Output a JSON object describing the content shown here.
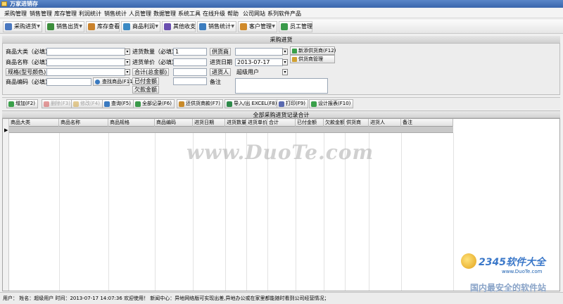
{
  "window": {
    "title": "万家进销存"
  },
  "menu": [
    "采购管理",
    "销售管理",
    "库存管理",
    "利润统计",
    "销售统计",
    "人员管理",
    "数据管理",
    "系统工具",
    "在线升级",
    "帮助",
    "公司网站",
    "系列软件产品"
  ],
  "toolbar": [
    {
      "label": "采购进货",
      "icon": "cart-icon",
      "color": "#4a78c0",
      "dropdown": true
    },
    {
      "label": "销售出货",
      "icon": "sales-icon",
      "color": "#3c8e3c",
      "dropdown": true
    },
    {
      "label": "库存查看",
      "icon": "box-icon",
      "color": "#c9822c",
      "dropdown": false
    },
    {
      "label": "商品利润",
      "icon": "profit-icon",
      "color": "#3b8ac4",
      "dropdown": true
    },
    {
      "label": "其他收支",
      "icon": "money-icon",
      "color": "#6a4fb0",
      "dropdown": false
    },
    {
      "label": "销售统计",
      "icon": "chart-icon",
      "color": "#3c7dbf",
      "dropdown": true
    },
    {
      "label": "客户管理",
      "icon": "customer-icon",
      "color": "#d08a2a",
      "dropdown": true
    },
    {
      "label": "员工管理",
      "icon": "staff-icon",
      "color": "#3a9a4a",
      "dropdown": false
    }
  ],
  "form": {
    "title": "采购进货",
    "category_label": "商品大类（必填）",
    "name_label": "商品名称（必填）",
    "spec_label": "规格(型号颜色)",
    "code_label": "商品编码（必填）",
    "search_goods": "查找商品(F11)",
    "qty_label": "进货数量（必填）",
    "qty_value": "1",
    "price_label": "进货单价（必填）",
    "total_label": "合计(总金额)",
    "paid_label": "已付金额",
    "owed_label": "欠款金额",
    "supplier_label": "供货商",
    "date_label": "进货日期",
    "date_value": "2013-07-17",
    "buyer_label": "进货人",
    "buyer_value": "超级用户",
    "note_label": "备注",
    "add_supplier": "新添供货商(F12)",
    "supplier_manage": "供货商管理"
  },
  "actions": [
    {
      "label": "增加(F2)",
      "icon": "add-icon",
      "color": "#3aa04a",
      "enabled": true
    },
    {
      "label": "删除(F3)",
      "icon": "delete-icon",
      "color": "#d04040",
      "enabled": false
    },
    {
      "label": "修改(F4)",
      "icon": "edit-icon",
      "color": "#d0a030",
      "enabled": false
    },
    {
      "label": "查询(F5)",
      "icon": "query-icon",
      "color": "#3a7ac0",
      "enabled": true
    },
    {
      "label": "全部记录(F6)",
      "icon": "all-records-icon",
      "color": "#3a9a4a",
      "enabled": true
    },
    {
      "label": "还供货商款(F7)",
      "icon": "repay-icon",
      "color": "#c88a2a",
      "enabled": true
    },
    {
      "label": "导入/出 EXCEL(F8)",
      "icon": "excel-icon",
      "color": "#2e8a4a",
      "enabled": true
    },
    {
      "label": "打印(F9)",
      "icon": "print-icon",
      "color": "#5a6ab0",
      "enabled": true
    },
    {
      "label": "设计报表(F10)",
      "icon": "report-icon",
      "color": "#3aa04a",
      "enabled": true
    }
  ],
  "grid": {
    "title": "全部采购进货记录合计",
    "columns": [
      "商品大类",
      "商品名称",
      "商品规格",
      "商品编码",
      "进货日期",
      "进货数量",
      "进货单价",
      "合计",
      "已付金额",
      "欠款金额",
      "供货商",
      "进货人",
      "备注"
    ]
  },
  "status": {
    "text": "用户：  姓名：超级用户  时间：2013-07-17 14:07:36 欢迎使用！   新闻中心：异地网络版可实现出差,异地办公或在家里都能随时看到公司经营情况；"
  },
  "watermark": {
    "center": "www.DuoTe.com",
    "brand": "2345软件大全",
    "site": "www.DuoTe.com",
    "slogan": "国内最安全的软件站"
  }
}
